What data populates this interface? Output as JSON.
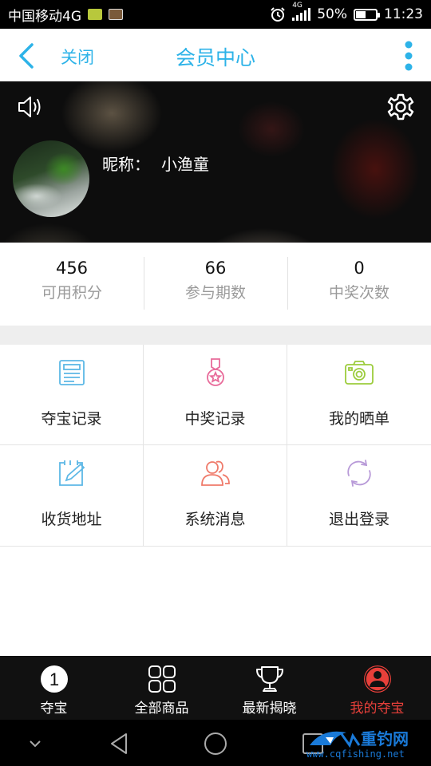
{
  "status_bar": {
    "carrier": "中国移动4G",
    "network_badge": "4G",
    "battery": "50%",
    "battery_level": 0.5,
    "time": "11:23",
    "icons": [
      "sim-card-icon",
      "gallery-icon",
      "alarm-icon",
      "signal-icon",
      "battery-icon"
    ]
  },
  "header": {
    "back_icon": "chevron-left-icon",
    "close_label": "关闭",
    "title": "会员中心",
    "more_icon": "more-vertical-icon",
    "accent_color": "#2db3e8"
  },
  "profile": {
    "sound_icon": "speaker-icon",
    "settings_icon": "gear-icon",
    "nickname_label": "昵称：",
    "nickname": "小渔童"
  },
  "stats": [
    {
      "value": "456",
      "label": "可用积分"
    },
    {
      "value": "66",
      "label": "参与期数"
    },
    {
      "value": "0",
      "label": "中奖次数"
    }
  ],
  "menu": [
    {
      "label": "夺宝记录",
      "icon": "record-list-icon",
      "color": "#5db8e6"
    },
    {
      "label": "中奖记录",
      "icon": "medal-icon",
      "color": "#e86b9a"
    },
    {
      "label": "我的晒单",
      "icon": "camera-icon",
      "color": "#9ccc3c"
    },
    {
      "label": "收货地址",
      "icon": "edit-calendar-icon",
      "color": "#5db8e6"
    },
    {
      "label": "系统消息",
      "icon": "users-icon",
      "color": "#ef7a6a"
    },
    {
      "label": "退出登录",
      "icon": "refresh-icon",
      "color": "#b89ad8"
    }
  ],
  "tabs": [
    {
      "label": "夺宝",
      "icon": "number-one-icon",
      "badge": "1"
    },
    {
      "label": "全部商品",
      "icon": "grid-icon"
    },
    {
      "label": "最新揭晓",
      "icon": "trophy-icon"
    },
    {
      "label": "我的夺宝",
      "icon": "user-icon",
      "active": true,
      "active_color": "#e8403a"
    }
  ],
  "nav_bar": {
    "icons": [
      "chevron-down-icon",
      "back-triangle-icon",
      "home-circle-icon",
      "recent-square-icon"
    ]
  },
  "watermark": {
    "name": "重钓网",
    "url": "www.cqfishing.net"
  }
}
